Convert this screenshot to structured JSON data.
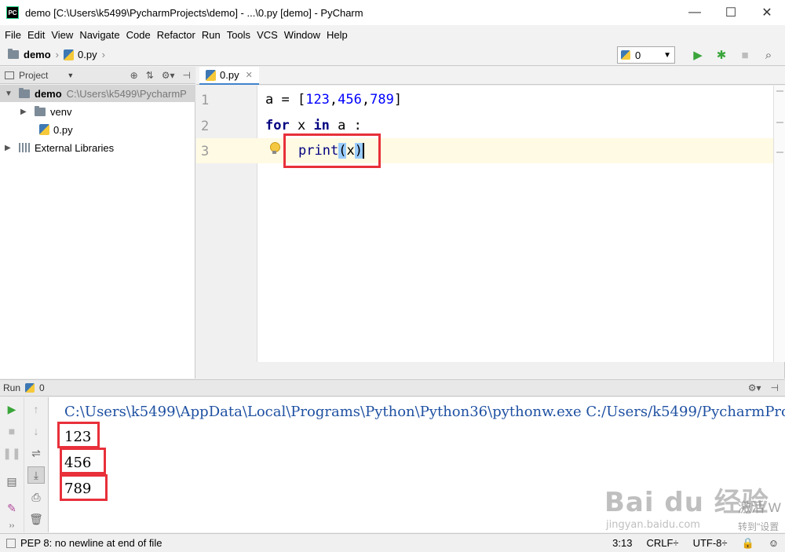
{
  "window": {
    "title": "demo [C:\\Users\\k5499\\PycharmProjects\\demo] - ...\\0.py [demo] - PyCharm",
    "logo": "PC",
    "minimize": "—",
    "maximize": "☐",
    "close": "✕"
  },
  "menu": [
    "File",
    "Edit",
    "View",
    "Navigate",
    "Code",
    "Refactor",
    "Run",
    "Tools",
    "VCS",
    "Window",
    "Help"
  ],
  "breadcrumb": {
    "project": "demo",
    "file": "0.py"
  },
  "toolbar": {
    "run_config": "0"
  },
  "project_panel": {
    "title": "Project",
    "root_name": "demo",
    "root_path": "C:\\Users\\k5499\\PycharmP",
    "venv": "venv",
    "file": "0.py",
    "external": "External Libraries"
  },
  "editor": {
    "tab": "0.py",
    "line_numbers": [
      "1",
      "2",
      "3"
    ],
    "line1": {
      "var": "a = ",
      "lb": "[",
      "n1": "123",
      "c1": ",",
      "n2": "456",
      "c2": ",",
      "n3": "789",
      "rb": "]"
    },
    "line2": {
      "kw1": "for",
      "mid": " x ",
      "kw2": "in",
      "tail": " a :"
    },
    "line3": {
      "fn": "print",
      "lp": "(",
      "arg": "x",
      "rp": ")"
    }
  },
  "run_panel": {
    "title": "Run",
    "config": "0",
    "command": "C:\\Users\\k5499\\AppData\\Local\\Programs\\Python\\Python36\\pythonw.exe C:/Users/k5499/PycharmProjects/demo/0.py",
    "output": [
      "123",
      "456",
      "789"
    ]
  },
  "watermark": {
    "brand": "Bai  du 经验",
    "url": "jingyan.baidu.com"
  },
  "activation": {
    "line1": "激活 W",
    "line2": "转到\"设置"
  },
  "status": {
    "message": "PEP 8: no newline at end of file",
    "position": "3:13",
    "line_sep": "CRLF÷",
    "encoding": "UTF-8÷"
  }
}
